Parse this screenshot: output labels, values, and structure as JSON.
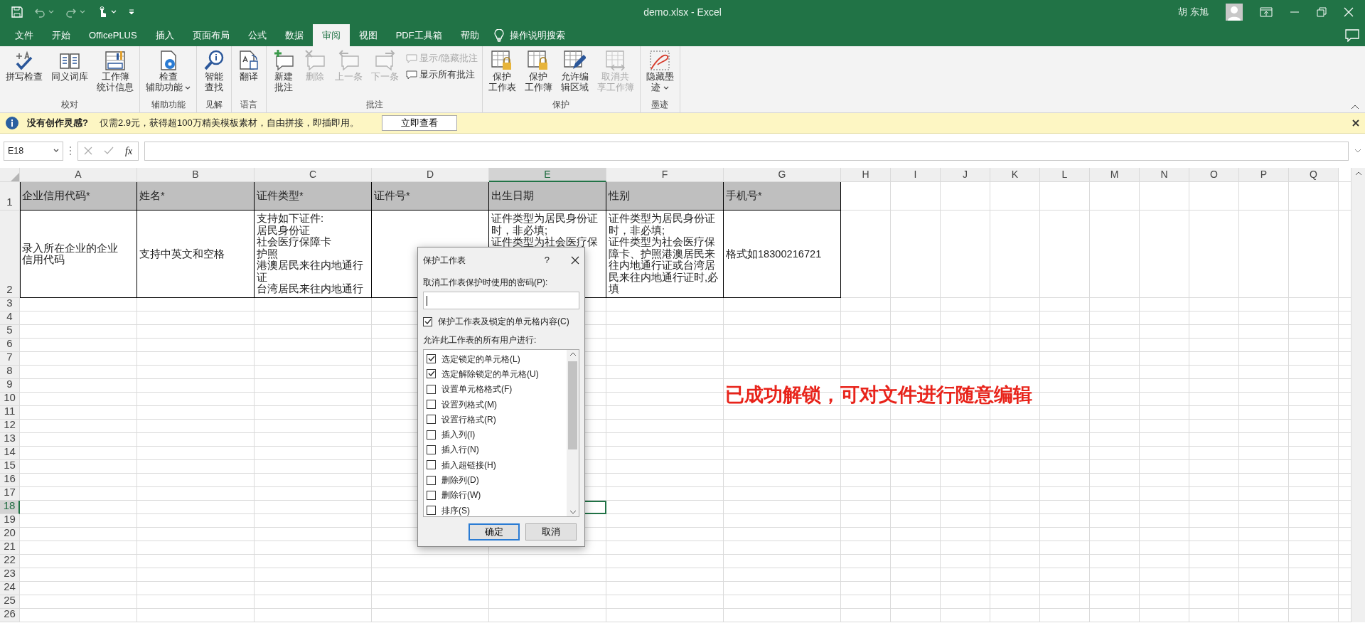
{
  "window": {
    "title": "demo.xlsx  -  Excel",
    "user": "胡 东旭"
  },
  "tabs": [
    {
      "label": "文件",
      "selected": false
    },
    {
      "label": "开始",
      "selected": false
    },
    {
      "label": "OfficePLUS",
      "selected": false
    },
    {
      "label": "插入",
      "selected": false
    },
    {
      "label": "页面布局",
      "selected": false
    },
    {
      "label": "公式",
      "selected": false
    },
    {
      "label": "数据",
      "selected": false
    },
    {
      "label": "审阅",
      "selected": true
    },
    {
      "label": "视图",
      "selected": false
    },
    {
      "label": "PDF工具箱",
      "selected": false
    },
    {
      "label": "帮助",
      "selected": false
    }
  ],
  "tell_me": "操作说明搜索",
  "ribbon_groups": [
    {
      "label": "校对",
      "buttons": [
        {
          "kind": "large",
          "label": [
            "拼写检查"
          ],
          "disabled": false,
          "dropdown": false
        },
        {
          "kind": "large",
          "label": [
            "同义词库"
          ],
          "disabled": false,
          "dropdown": false
        },
        {
          "kind": "large",
          "label": [
            "工作簿",
            "统计信息"
          ],
          "disabled": false,
          "dropdown": false
        }
      ]
    },
    {
      "label": "辅助功能",
      "buttons": [
        {
          "kind": "large",
          "label": [
            "检查",
            "辅助功能"
          ],
          "disabled": false,
          "dropdown": true
        }
      ]
    },
    {
      "label": "见解",
      "buttons": [
        {
          "kind": "large",
          "label": [
            "智能",
            "查找"
          ],
          "disabled": false,
          "dropdown": false
        }
      ]
    },
    {
      "label": "语言",
      "buttons": [
        {
          "kind": "large",
          "label": [
            "翻译"
          ],
          "disabled": false,
          "dropdown": false
        }
      ]
    },
    {
      "label": "批注",
      "buttons": [
        {
          "kind": "large",
          "label": [
            "新建",
            "批注"
          ],
          "disabled": false,
          "dropdown": false
        },
        {
          "kind": "large",
          "label": [
            "删除"
          ],
          "disabled": true,
          "dropdown": false
        },
        {
          "kind": "large",
          "label": [
            "上一条"
          ],
          "disabled": true,
          "dropdown": false
        },
        {
          "kind": "large",
          "label": [
            "下一条"
          ],
          "disabled": true,
          "dropdown": false
        },
        {
          "kind": "small",
          "label": [
            "显示/隐藏批注"
          ],
          "disabled": true,
          "dropdown": false
        },
        {
          "kind": "small",
          "label": [
            "显示所有批注"
          ],
          "disabled": false,
          "dropdown": false
        }
      ]
    },
    {
      "label": "保护",
      "buttons": [
        {
          "kind": "large",
          "label": [
            "保护",
            "工作表"
          ],
          "disabled": false,
          "dropdown": false
        },
        {
          "kind": "large",
          "label": [
            "保护",
            "工作簿"
          ],
          "disabled": false,
          "dropdown": false
        },
        {
          "kind": "large",
          "label": [
            "允许编",
            "辑区域"
          ],
          "disabled": false,
          "dropdown": false
        },
        {
          "kind": "large",
          "label": [
            "取消共",
            "享工作簿"
          ],
          "disabled": true,
          "dropdown": false
        }
      ]
    },
    {
      "label": "墨迹",
      "buttons": [
        {
          "kind": "large",
          "label": [
            "隐藏墨",
            "迹"
          ],
          "disabled": false,
          "dropdown": true
        }
      ]
    }
  ],
  "info_bar": {
    "title": "没有创作灵感?",
    "message": "仅需2.9元，获得超100万精美模板素材，自由拼接，即插即用。",
    "button": "立即查看"
  },
  "formula_bar": {
    "name_box": "E18",
    "function_label": "fx"
  },
  "sheet": {
    "columns": [
      {
        "label": "A",
        "selected": false
      },
      {
        "label": "B",
        "selected": false
      },
      {
        "label": "C",
        "selected": false
      },
      {
        "label": "D",
        "selected": false
      },
      {
        "label": "E",
        "selected": true
      },
      {
        "label": "F",
        "selected": false
      },
      {
        "label": "G",
        "selected": false
      },
      {
        "label": "H",
        "selected": false
      },
      {
        "label": "I",
        "selected": false
      },
      {
        "label": "J",
        "selected": false
      },
      {
        "label": "K",
        "selected": false
      },
      {
        "label": "L",
        "selected": false
      },
      {
        "label": "M",
        "selected": false
      },
      {
        "label": "N",
        "selected": false
      },
      {
        "label": "O",
        "selected": false
      },
      {
        "label": "P",
        "selected": false
      },
      {
        "label": "Q",
        "selected": false
      }
    ],
    "rows": [
      {
        "label": "1",
        "selected": false,
        "cells": [
          [
            "企业信用代码*"
          ],
          [
            "姓名*"
          ],
          [
            "证件类型*"
          ],
          [
            "证件号*"
          ],
          [
            "出生日期"
          ],
          [
            "性别"
          ],
          [
            "手机号*"
          ]
        ]
      },
      {
        "label": "2",
        "selected": false,
        "cells": [
          [
            "录入所在企业的企业",
            "信用代码"
          ],
          [
            "支持中英文和空格"
          ],
          [
            "支持如下证件:",
            "居民身份证",
            "社会医疗保障卡",
            "护照",
            "港澳居民来往内地通行证",
            "台湾居民来往内地通行"
          ],
          null,
          [
            "证件类型为居民身份证时，非必填;",
            "证件类型为社会医疗保"
          ],
          [
            "证件类型为居民身份证时，非必填;",
            "证件类型为社会医疗保障卡、护照港澳居民来往内地通行证或台湾居民来往内地通行证时,必填"
          ],
          [
            "格式如18300216721"
          ]
        ]
      },
      {
        "label": "3",
        "selected": false
      },
      {
        "label": "4",
        "selected": false
      },
      {
        "label": "5",
        "selected": false
      },
      {
        "label": "6",
        "selected": false
      },
      {
        "label": "7",
        "selected": false
      },
      {
        "label": "8",
        "selected": false
      },
      {
        "label": "9",
        "selected": false
      },
      {
        "label": "10",
        "selected": false
      },
      {
        "label": "11",
        "selected": false
      },
      {
        "label": "12",
        "selected": false
      },
      {
        "label": "13",
        "selected": false
      },
      {
        "label": "14",
        "selected": false
      },
      {
        "label": "15",
        "selected": false
      },
      {
        "label": "16",
        "selected": false
      },
      {
        "label": "17",
        "selected": false
      },
      {
        "label": "18",
        "selected": true
      },
      {
        "label": "19",
        "selected": false
      },
      {
        "label": "20",
        "selected": false
      },
      {
        "label": "21",
        "selected": false
      },
      {
        "label": "22",
        "selected": false
      },
      {
        "label": "23",
        "selected": false
      },
      {
        "label": "24",
        "selected": false
      },
      {
        "label": "25",
        "selected": false
      },
      {
        "label": "26",
        "selected": false
      }
    ]
  },
  "dialog": {
    "title": "保护工作表",
    "help": "?",
    "password_label": "取消工作表保护时使用的密码(P):",
    "protect": {
      "label": "保护工作表及锁定的单元格内容(C)",
      "checked": true
    },
    "allow_label": "允许此工作表的所有用户进行:",
    "permissions": [
      {
        "label": "选定锁定的单元格(L)",
        "checked": true
      },
      {
        "label": "选定解除锁定的单元格(U)",
        "checked": true
      },
      {
        "label": "设置单元格格式(F)",
        "checked": false
      },
      {
        "label": "设置列格式(M)",
        "checked": false
      },
      {
        "label": "设置行格式(R)",
        "checked": false
      },
      {
        "label": "插入列(I)",
        "checked": false
      },
      {
        "label": "插入行(N)",
        "checked": false
      },
      {
        "label": "插入超链接(H)",
        "checked": false
      },
      {
        "label": "删除列(D)",
        "checked": false
      },
      {
        "label": "删除行(W)",
        "checked": false
      },
      {
        "label": "排序(S)",
        "checked": false
      }
    ],
    "buttons": [
      {
        "label": "确定",
        "default": true
      },
      {
        "label": "取消",
        "default": false
      }
    ]
  },
  "annotation": {
    "text": "已成功解锁，可对文件进行随意编辑"
  }
}
